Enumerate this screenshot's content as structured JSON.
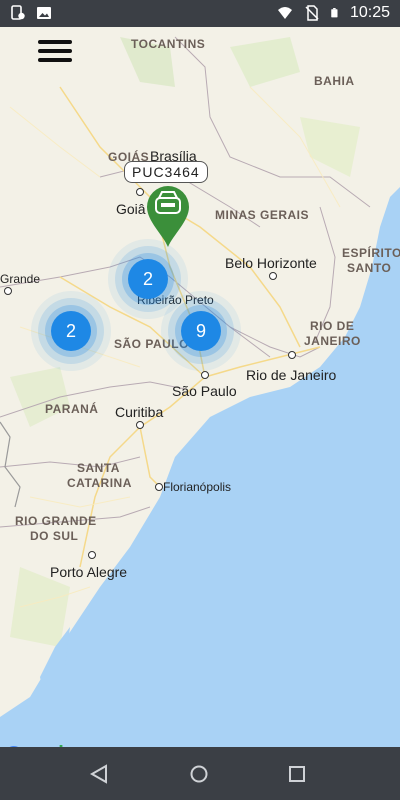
{
  "status_bar": {
    "time": "10:25",
    "left_icons": [
      "notification-app-icon",
      "image-icon"
    ],
    "right_icons": [
      "wifi-icon",
      "no-sim-icon",
      "battery-icon"
    ]
  },
  "map": {
    "regions": {
      "tocantins": "TOCANTINS",
      "bahia": "BAHIA",
      "goias": "GOIÁS",
      "minas_gerais": "MINAS GERAIS",
      "espirito_santo_1": "ESPÍRITO",
      "espirito_santo_2": "SANTO",
      "sao_paulo_state": "SÃO PAULO",
      "rio_de_janeiro_state_1": "RIO DE",
      "rio_de_janeiro_state_2": "JANEIRO",
      "parana": "PARANÁ",
      "santa_catarina_1": "SANTA",
      "santa_catarina_2": "CATARINA",
      "rio_grande_do_sul_1": "RIO GRANDE",
      "rio_grande_do_sul_2": "DO SUL"
    },
    "cities": {
      "brasilia": "Brasília",
      "goiania": "Goiâ",
      "grande": "Grande",
      "belo_horizonte": "Belo Horizonte",
      "ribeirao_preto": "Ribeirão Preto",
      "sao_paulo": "São Paulo",
      "rio_de_janeiro": "Rio de Janeiro",
      "curitiba": "Curitiba",
      "florianopolis": "Florianópolis",
      "porto_alegre": "Porto Alegre"
    },
    "clusters": [
      {
        "count": "2"
      },
      {
        "count": "2"
      },
      {
        "count": "9"
      }
    ],
    "vehicle": {
      "plate": "PUC3464",
      "icon": "car-icon"
    },
    "colors": {
      "land": "#f3f1e7",
      "water": "#a9d2f5",
      "cluster": "#1e88e5",
      "marker": "#3b8f3a"
    },
    "attribution": {
      "g1": "G",
      "g2": "o",
      "g3": "o",
      "g4": "g",
      "g5": "l",
      "g6": "e"
    }
  },
  "nav_bar": {
    "buttons": [
      "back-icon",
      "home-icon",
      "recents-icon"
    ]
  }
}
